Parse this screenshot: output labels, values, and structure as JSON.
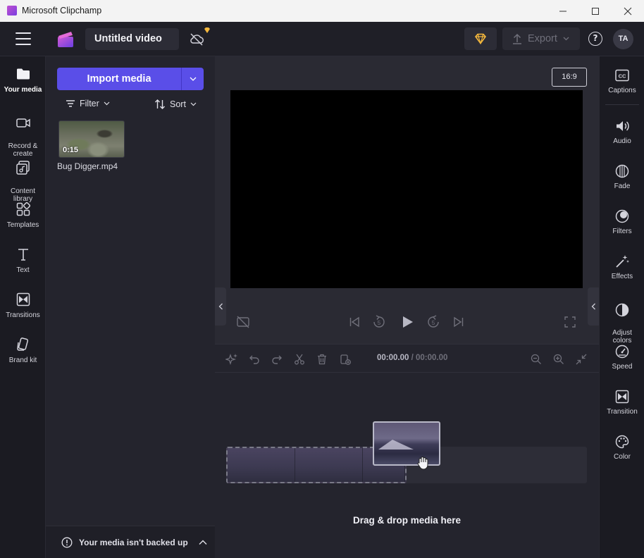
{
  "window": {
    "title": "Microsoft Clipchamp"
  },
  "header": {
    "project_title": "Untitled video",
    "export_label": "Export",
    "avatar_initials": "TA",
    "help_label": "?"
  },
  "left_rail": {
    "items": [
      {
        "label": "Your media",
        "icon": "folder-icon"
      },
      {
        "label": "Record &\ncreate",
        "icon": "camera-icon"
      },
      {
        "label": "Content\nlibrary",
        "icon": "library-icon"
      },
      {
        "label": "Templates",
        "icon": "templates-icon"
      },
      {
        "label": "Text",
        "icon": "text-icon"
      },
      {
        "label": "Transitions",
        "icon": "transitions-icon"
      },
      {
        "label": "Brand kit",
        "icon": "brand-kit-icon"
      }
    ]
  },
  "media": {
    "import_label": "Import media",
    "filter_label": "Filter",
    "sort_label": "Sort",
    "items": [
      {
        "name": "Bug Digger.mp4",
        "duration": "0:15"
      }
    ],
    "backup_notice": "Your media isn't backed up"
  },
  "preview": {
    "aspect_ratio": "16:9"
  },
  "timeline": {
    "current_time": "00:00.00",
    "total_time": "/ 00:00.00",
    "drop_hint": "Drag & drop media here"
  },
  "right_rail": {
    "items": [
      {
        "label": "Captions",
        "icon": "captions-icon"
      },
      {
        "label": "Audio",
        "icon": "speaker-icon"
      },
      {
        "label": "Fade",
        "icon": "fade-icon"
      },
      {
        "label": "Filters",
        "icon": "filters-icon"
      },
      {
        "label": "Effects",
        "icon": "magic-wand-icon"
      },
      {
        "label": "Adjust\ncolors",
        "icon": "contrast-icon"
      },
      {
        "label": "Speed",
        "icon": "speedometer-icon"
      },
      {
        "label": "Transition",
        "icon": "transition-icon"
      },
      {
        "label": "Color",
        "icon": "palette-icon"
      }
    ]
  },
  "colors": {
    "accent": "#5a4ee8",
    "premium": "#f5b83d"
  }
}
